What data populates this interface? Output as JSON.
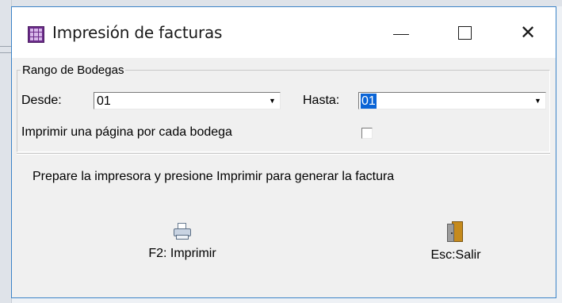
{
  "window": {
    "title": "Impresión de facturas",
    "icon": "app-grid-icon",
    "controls": [
      "minimize-icon",
      "maximize-icon",
      "close-icon"
    ]
  },
  "rango": {
    "legend": "Rango de Bodegas",
    "desde_label": "Desde:",
    "desde_value": "01",
    "hasta_label": "Hasta:",
    "hasta_value": "01",
    "checkbox_label": "Imprimir una página por cada bodega",
    "checkbox_checked": false
  },
  "instruction": "Prepare la impresora y presione Imprimir para generar la factura",
  "actions": {
    "print_label": "F2: Imprimir",
    "print_icon": "printer-icon",
    "exit_label": "Esc:Salir",
    "exit_icon": "door-icon"
  },
  "colors": {
    "accent": "#0a64d6",
    "window_border": "#3c84c8",
    "dialog_bg": "#f0f0f0"
  }
}
